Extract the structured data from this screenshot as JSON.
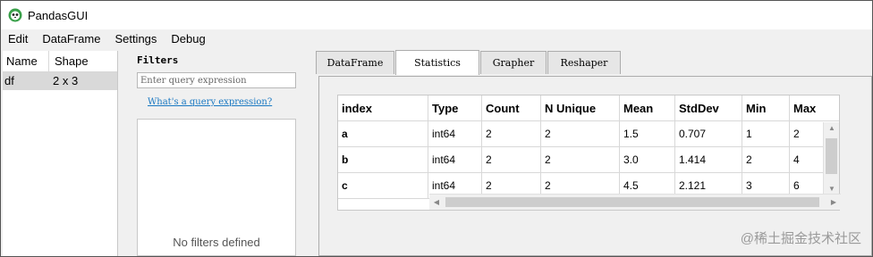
{
  "window": {
    "title": "PandasGUI"
  },
  "menubar": {
    "items": [
      "Edit",
      "DataFrame",
      "Settings",
      "Debug"
    ]
  },
  "dataframes": {
    "headers": [
      "Name",
      "Shape"
    ],
    "rows": [
      {
        "name": "df",
        "shape": "2 x 3"
      }
    ]
  },
  "filters": {
    "title": "Filters",
    "placeholder": "Enter query expression",
    "link_text": "What's a query expression?",
    "empty_text": "No filters defined"
  },
  "tabs": {
    "items": [
      "DataFrame",
      "Statistics",
      "Grapher",
      "Reshaper"
    ],
    "active": "Statistics"
  },
  "statistics": {
    "columns": [
      "index",
      "Type",
      "Count",
      "N Unique",
      "Mean",
      "StdDev",
      "Min",
      "Max"
    ],
    "rows": [
      [
        "a",
        "int64",
        "2",
        "2",
        "1.5",
        "0.707",
        "1",
        "2"
      ],
      [
        "b",
        "int64",
        "2",
        "2",
        "3.0",
        "1.414",
        "2",
        "4"
      ],
      [
        "c",
        "int64",
        "2",
        "2",
        "4.5",
        "2.121",
        "3",
        "6"
      ]
    ]
  },
  "watermark": "@稀土掘金技术社区",
  "colors": {
    "accent": "#1a78c2",
    "selection": "#d9d9d9",
    "window_bg": "#f0f0f0"
  }
}
